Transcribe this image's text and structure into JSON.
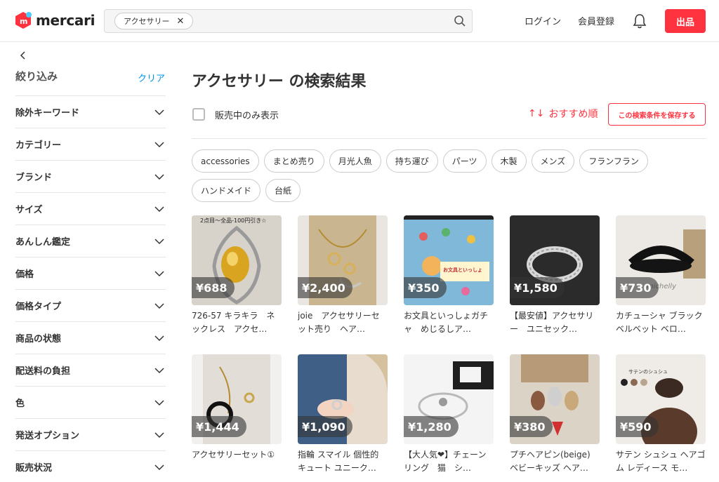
{
  "header": {
    "logo_text": "mercari",
    "search_chip": "アクセサリー",
    "login": "ログイン",
    "signup": "会員登録",
    "sell": "出品"
  },
  "sidebar": {
    "title": "絞り込み",
    "clear": "クリア",
    "filters": [
      "除外キーワード",
      "カテゴリー",
      "ブランド",
      "サイズ",
      "あんしん鑑定",
      "価格",
      "価格タイプ",
      "商品の状態",
      "配送料の負担",
      "色",
      "発送オプション",
      "販売状況"
    ]
  },
  "main": {
    "title": "アクセサリー の検索結果",
    "onsale_only": "販売中のみ表示",
    "sort": "おすすめ順",
    "save_search": "この検索条件を保存する",
    "tags": [
      "accessories",
      "まとめ売り",
      "月光人魚",
      "持ち運び",
      "パーツ",
      "木製",
      "メンズ",
      "フランフラン",
      "ハンドメイド",
      "台紙"
    ]
  },
  "items": [
    {
      "price": "¥688",
      "name": "726-57 キラキラ　ネックレス　アクセ…",
      "overlay": "2点目〜全品-100円引き☆"
    },
    {
      "price": "¥2,400",
      "name": "joie　アクセサリーセット売り　ヘア…"
    },
    {
      "price": "¥350",
      "name": "お文具といっしょガチャ　めじるしア…",
      "overlay": "お文具といっしょ"
    },
    {
      "price": "¥1,580",
      "name": "【最安値】アクセサリー　ユニセック…"
    },
    {
      "price": "¥730",
      "name": "カチューシャ ブラック ベルベット ベロ…",
      "overlay": "michelly"
    },
    {
      "price": "¥1,444",
      "name": "アクセサリーセット①"
    },
    {
      "price": "¥1,090",
      "name": "指輪 スマイル 個性的 キュート ユニーク…"
    },
    {
      "price": "¥1,280",
      "name": "【大人気❤】チェーンリング　猫　シ…"
    },
    {
      "price": "¥380",
      "name": "プチヘアピン(beige) ベビーキッズ ヘア…"
    },
    {
      "price": "¥590",
      "name": "サテン シュシュ ヘアゴム レディース モ…",
      "overlay": "サテンのシュシュ"
    }
  ],
  "colors": {
    "brand_red": "#ff333f",
    "link_blue": "#0095ee"
  }
}
